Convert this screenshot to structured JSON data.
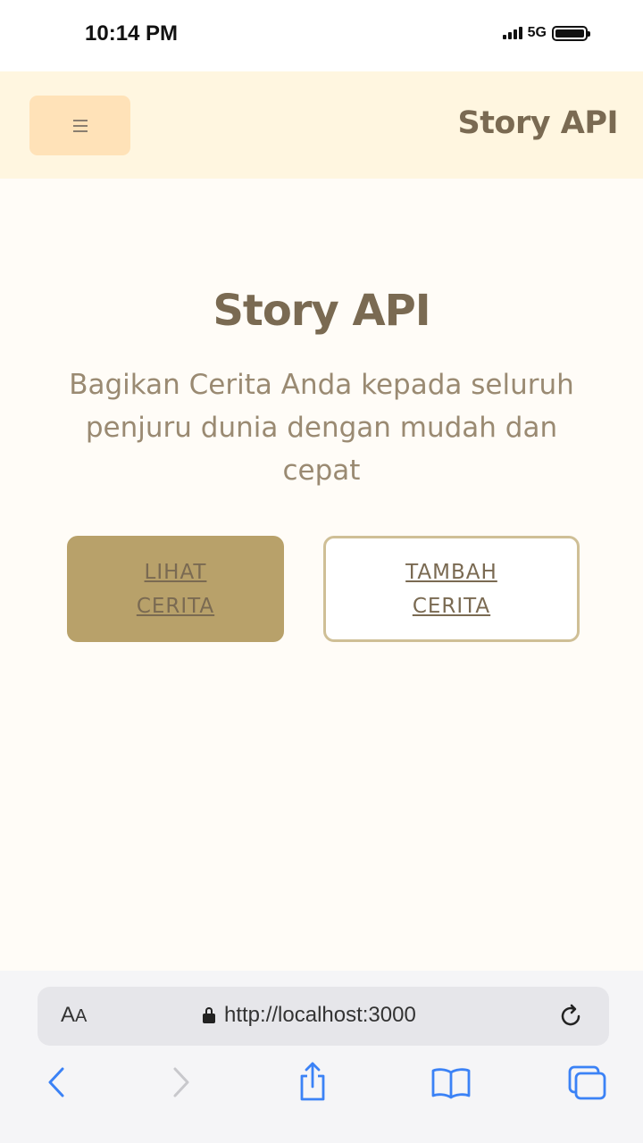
{
  "status_bar": {
    "time": "10:14 PM",
    "network": "5G",
    "icons": [
      "signal-icon",
      "battery-icon"
    ]
  },
  "header": {
    "menu_icon": "menu-icon",
    "title": "Story API"
  },
  "hero": {
    "title": "Story API",
    "subtitle": "Bagikan Cerita Anda kepada seluruh penjuru dunia dengan mudah dan cepat",
    "primary_button": {
      "line1": "LIHAT",
      "line2": "CERITA"
    },
    "secondary_button": {
      "line1": "TAMBAH",
      "line2": "CERITA"
    }
  },
  "browser": {
    "aa_label_big": "A",
    "aa_label_small": "A",
    "url": "http://localhost:3000",
    "icons": [
      "lock-icon",
      "reload-icon",
      "back-icon",
      "forward-icon",
      "share-icon",
      "bookmarks-icon",
      "tabs-icon"
    ]
  },
  "colors": {
    "accent": "#b8a16a",
    "header_bg": "#fff6e0",
    "menu_button_bg": "#ffe2b8",
    "text": "#7a6a52",
    "ios_blue": "#3b82f6"
  }
}
